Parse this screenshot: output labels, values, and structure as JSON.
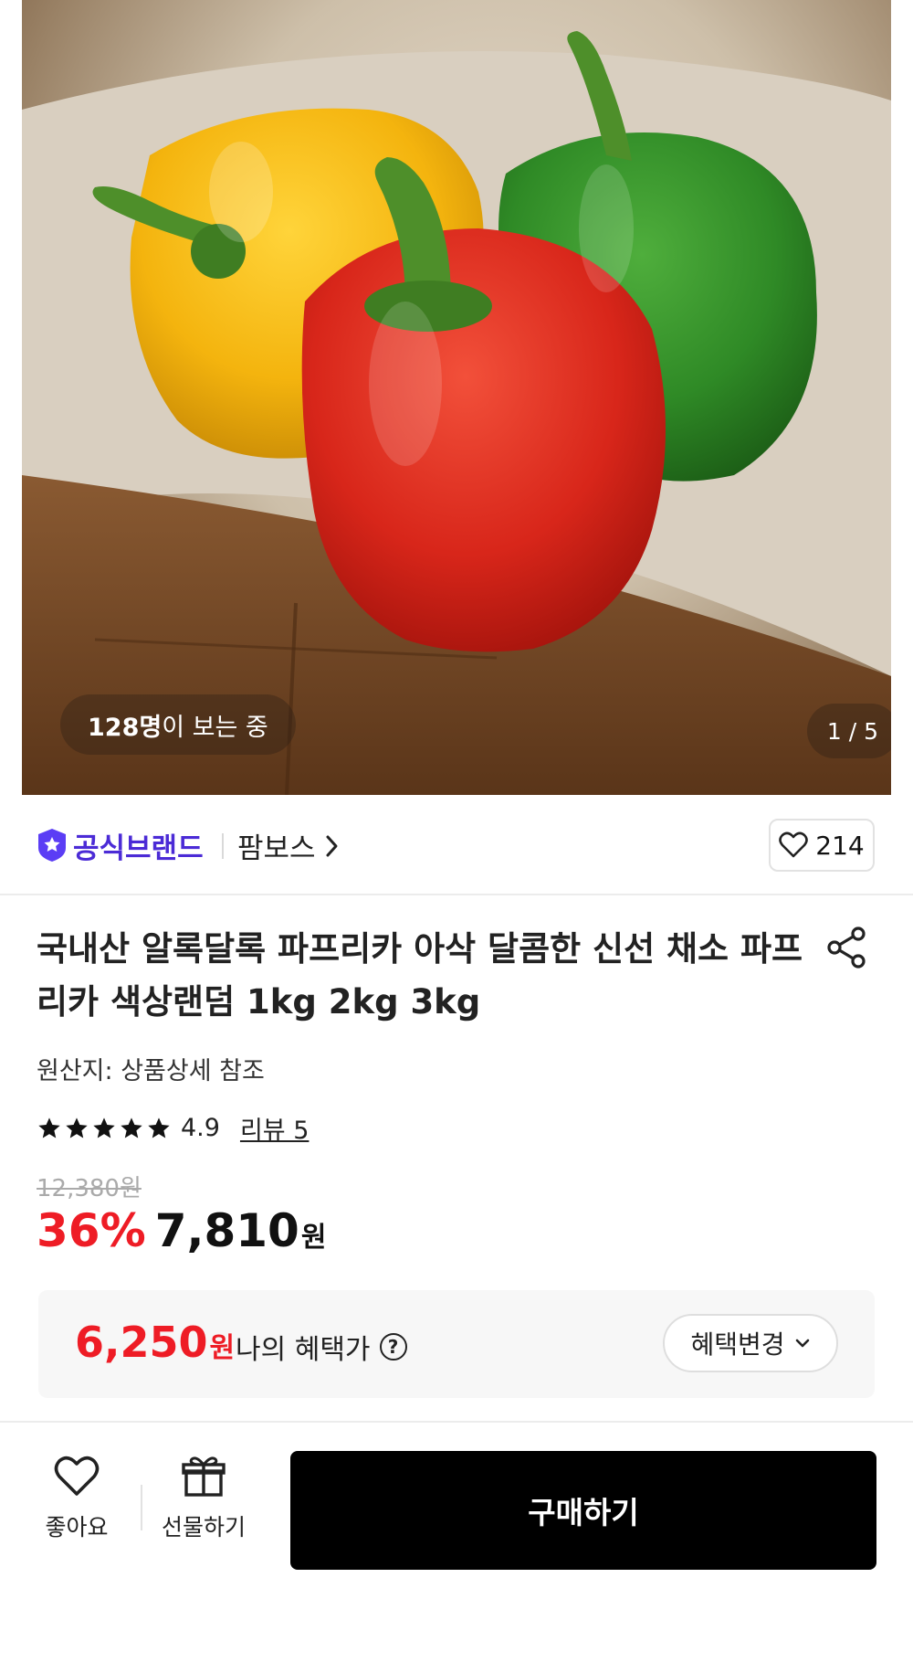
{
  "hero": {
    "viewers_count": "128명",
    "viewers_suffix": "이 보는 중",
    "image_counter": "1 / 5"
  },
  "brand": {
    "badge_label": "공식브랜드",
    "store_name": "팜보스",
    "like_count": "214"
  },
  "product": {
    "title": "국내산 알록달록 파프리카 아삭 달콤한 신선 채소 파프리카 색상랜덤 1kg 2kg 3kg",
    "origin": "원산지: 상품상세 참조",
    "rating": "4.9",
    "rating_stars": 5,
    "review_link": "리뷰 5",
    "original_price": "12,380원",
    "discount": "36%",
    "sale_price": "7,810",
    "currency": "원"
  },
  "benefit": {
    "price": "6,250",
    "currency": "원",
    "label": "나의 혜택가",
    "help": "?",
    "change_button": "혜택변경"
  },
  "bottom_bar": {
    "like_label": "좋아요",
    "gift_label": "선물하기",
    "buy_label": "구매하기"
  },
  "colors": {
    "brand_purple": "#4b2bd6",
    "discount_red": "#ee1c25",
    "buy_button": "#000000"
  },
  "icons": [
    "star-badge-icon",
    "chevron-right-icon",
    "heart-icon",
    "share-icon",
    "star-icon",
    "help-icon",
    "chevron-down-icon",
    "gift-icon"
  ]
}
